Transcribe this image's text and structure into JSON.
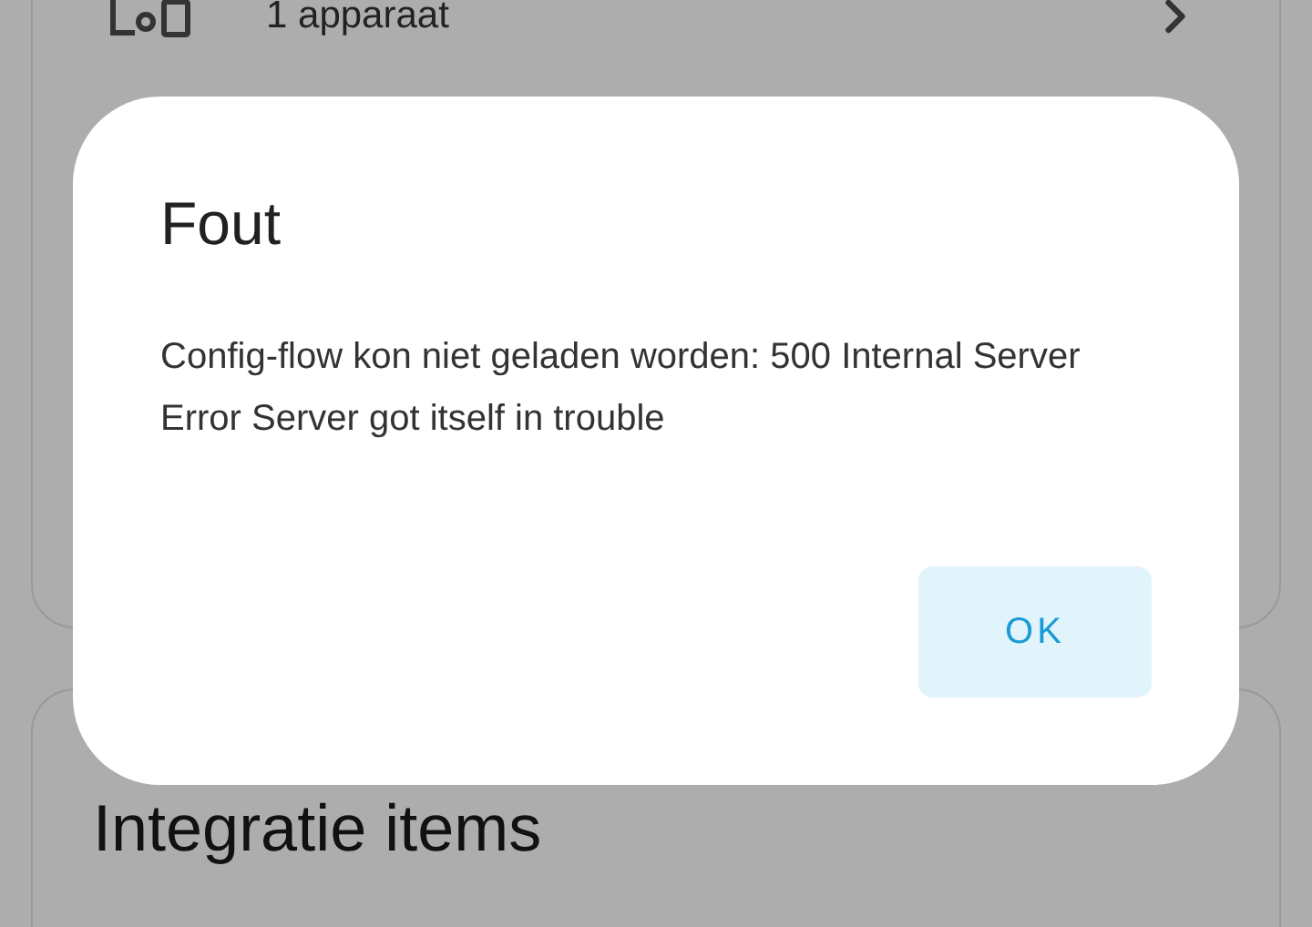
{
  "device_card": {
    "row_label": "1 apparaat"
  },
  "entities_card": {
    "title": "Integratie items"
  },
  "dialog": {
    "title": "Fout",
    "message": "Config-flow kon niet geladen worden: 500 Internal Server Error Server got itself in trouble",
    "buttons": [
      "OK"
    ]
  }
}
